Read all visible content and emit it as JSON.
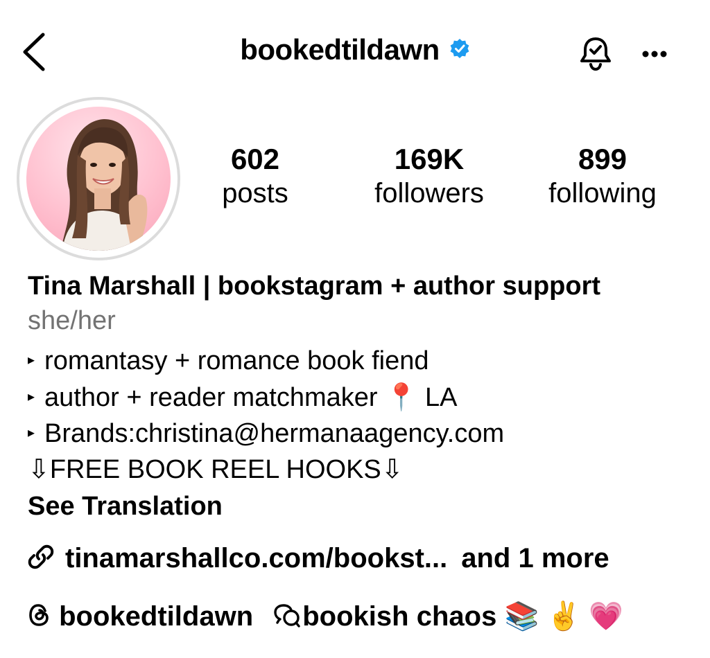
{
  "header": {
    "username": "bookedtildawn",
    "verified_color": "#1d9bf0"
  },
  "icons": {
    "back": "chevron-left-icon",
    "verified": "verified-badge-icon",
    "notifications": "bell-check-icon",
    "more": "more-horizontal-icon",
    "link": "link-icon",
    "threads": "threads-icon",
    "topic": "speech-bubbles-icon"
  },
  "stats": {
    "posts": {
      "value": "602",
      "label": "posts"
    },
    "followers": {
      "value": "169K",
      "label": "followers"
    },
    "following": {
      "value": "899",
      "label": "following"
    }
  },
  "profile": {
    "display_name": "Tina Marshall | bookstagram + author support",
    "pronouns": "she/her",
    "bio_lines": [
      "romantasy + romance book fiend",
      "author + reader matchmaker",
      "Brands:christina@hermanaagency.com",
      "⇩FREE BOOK REEL HOOKS⇩"
    ],
    "bio_pin": "📍",
    "bio_location": "LA",
    "bullet": "▸",
    "see_translation": "See Translation",
    "link_text": "tinamarshallco.com/bookst...",
    "link_more": "and 1 more",
    "threads_handle": "bookedtildawn",
    "topic_text": "bookish chaos",
    "topic_emojis": "📚 ✌️ 💗"
  },
  "colors": {
    "text": "#000000",
    "secondary": "#737373",
    "avatar_ring": "#dcdcdc"
  }
}
